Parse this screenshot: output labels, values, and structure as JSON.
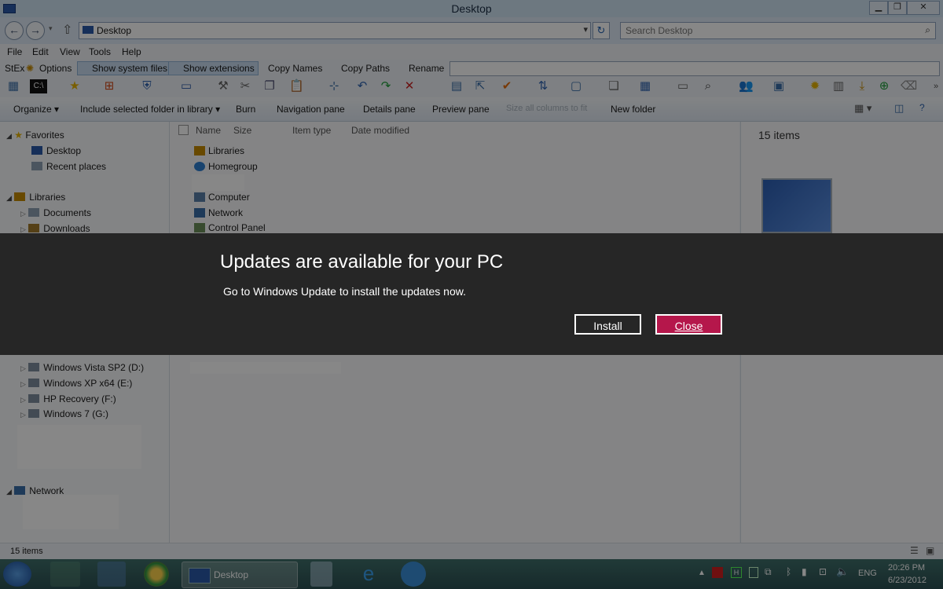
{
  "window": {
    "title": "Desktop",
    "address": "Desktop",
    "search_placeholder": "Search Desktop"
  },
  "menu": [
    "File",
    "Edit",
    "View",
    "Tools",
    "Help"
  ],
  "stex_bar": {
    "label": "StEx",
    "options": "Options",
    "show_system_files": "Show system files",
    "show_extensions": "Show extensions",
    "copy_names": "Copy Names",
    "copy_paths": "Copy Paths",
    "rename": "Rename"
  },
  "command_bar": {
    "organize": "Organize ▾",
    "include": "Include selected folder in library ▾",
    "burn": "Burn",
    "navigation_pane": "Navigation pane",
    "details_pane": "Details pane",
    "preview_pane": "Preview pane",
    "size_columns": "Size all columns to fit",
    "new_folder": "New folder"
  },
  "nav_tree": {
    "favorites": "Favorites",
    "desktop": "Desktop",
    "recent_places": "Recent places",
    "libraries": "Libraries",
    "documents": "Documents",
    "downloads": "Downloads",
    "drive_d": "Windows Vista SP2 (D:)",
    "drive_e": "Windows XP x64 (E:)",
    "drive_f": "HP Recovery (F:)",
    "drive_g": "Windows 7 (G:)",
    "network": "Network"
  },
  "columns": {
    "name": "Name",
    "size": "Size",
    "item_type": "Item type",
    "date_modified": "Date modified"
  },
  "files": [
    "Libraries",
    "Homegroup",
    "Computer",
    "Network",
    "Control Panel"
  ],
  "details": {
    "count": "15 items"
  },
  "status": {
    "count": "15 items"
  },
  "toast": {
    "title": "Updates are available for your PC",
    "message": "Go to Windows Update to install the updates now.",
    "install": "Install",
    "close": "Close"
  },
  "taskbar": {
    "explorer_label": "Desktop",
    "lang": "ENG",
    "time": "20:26 PM",
    "date": "6/23/2012"
  },
  "colors": {
    "toast_bg": "#262626",
    "close_button": "#b5174b"
  }
}
